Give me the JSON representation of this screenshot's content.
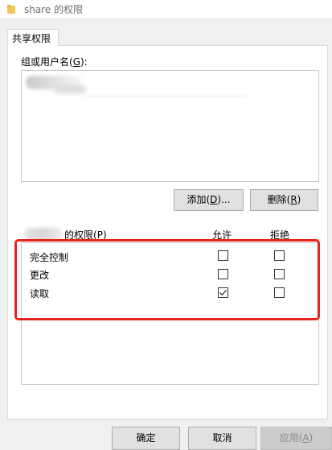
{
  "window": {
    "title": "share 的权限"
  },
  "tabs": [
    {
      "label": "共享权限"
    }
  ],
  "groups": {
    "label_prefix": "组或用户名(",
    "label_key": "G",
    "label_suffix": "):"
  },
  "buttons": {
    "add": {
      "prefix": "添加(",
      "key": "D",
      "suffix": ")..."
    },
    "remove": {
      "prefix": "删除(",
      "key": "R",
      "suffix": ")"
    },
    "ok": "确定",
    "cancel": "取消",
    "apply": {
      "prefix": "应用(",
      "key": "A",
      "suffix": ")"
    }
  },
  "permissions": {
    "label_prefix": "的权限(",
    "label_key": "P",
    "label_suffix": ")",
    "allow_header": "允许",
    "deny_header": "拒绝",
    "rows": [
      {
        "name": "完全控制",
        "allow": false,
        "deny": false
      },
      {
        "name": "更改",
        "allow": false,
        "deny": false
      },
      {
        "name": "读取",
        "allow": true,
        "deny": false
      }
    ]
  },
  "colors": {
    "highlight": "#e8231f",
    "folder": "#e8b540"
  }
}
